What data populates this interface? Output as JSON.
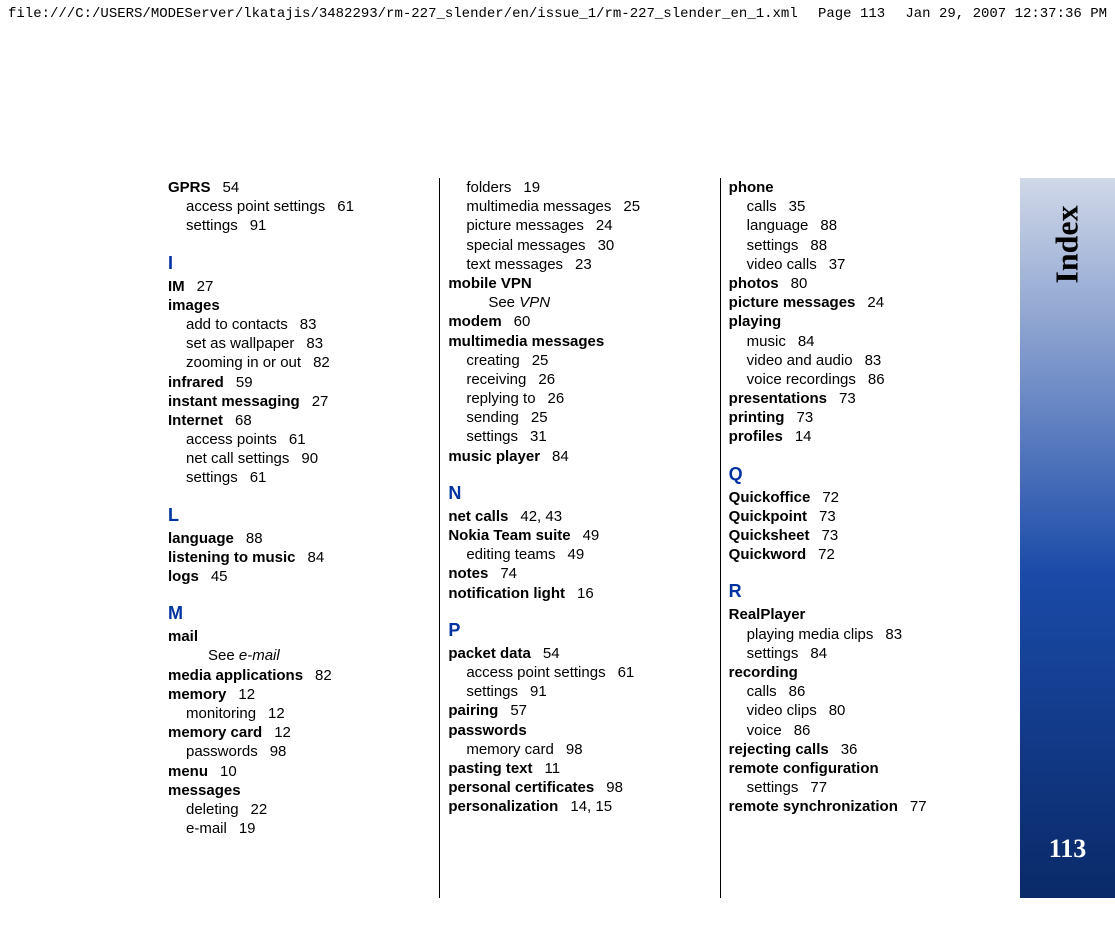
{
  "header": {
    "path": "file:///C:/USERS/MODEServer/lkatajis/3482293/rm-227_slender/en/issue_1/rm-227_slender_en_1.xml",
    "page": "Page 113",
    "timestamp": "Jan 29, 2007 12:37:36 PM"
  },
  "sidebar": {
    "title": "Index",
    "page": "113"
  },
  "col1": [
    {
      "t": "top",
      "text": "GPRS",
      "pg": "54"
    },
    {
      "t": "sub",
      "text": "access point settings",
      "pg": "61"
    },
    {
      "t": "sub",
      "text": "settings",
      "pg": "91"
    },
    {
      "t": "letter",
      "text": "I"
    },
    {
      "t": "top",
      "text": "IM",
      "pg": "27"
    },
    {
      "t": "top",
      "text": "images",
      "pg": ""
    },
    {
      "t": "sub",
      "text": "add to contacts",
      "pg": "83"
    },
    {
      "t": "sub",
      "text": "set as wallpaper",
      "pg": "83"
    },
    {
      "t": "sub",
      "text": "zooming in or out",
      "pg": "82"
    },
    {
      "t": "top",
      "text": "infrared",
      "pg": "59"
    },
    {
      "t": "top",
      "text": "instant messaging",
      "pg": "27"
    },
    {
      "t": "top",
      "text": "Internet",
      "pg": "68"
    },
    {
      "t": "sub",
      "text": "access points",
      "pg": "61"
    },
    {
      "t": "sub",
      "text": "net call settings",
      "pg": "90"
    },
    {
      "t": "sub",
      "text": "settings",
      "pg": "61"
    },
    {
      "t": "letter",
      "text": "L"
    },
    {
      "t": "top",
      "text": "language",
      "pg": "88"
    },
    {
      "t": "top",
      "text": "listening to music",
      "pg": "84"
    },
    {
      "t": "top",
      "text": "logs",
      "pg": "45"
    },
    {
      "t": "letter",
      "text": "M"
    },
    {
      "t": "top",
      "text": "mail",
      "pg": ""
    },
    {
      "t": "see",
      "label": "See ",
      "ref": "e-mail"
    },
    {
      "t": "top",
      "text": "media applications",
      "pg": "82"
    },
    {
      "t": "top",
      "text": "memory",
      "pg": "12"
    },
    {
      "t": "sub",
      "text": "monitoring",
      "pg": "12"
    },
    {
      "t": "top",
      "text": "memory card",
      "pg": "12"
    },
    {
      "t": "sub",
      "text": "passwords",
      "pg": "98"
    },
    {
      "t": "top",
      "text": "menu",
      "pg": "10"
    },
    {
      "t": "top",
      "text": "messages",
      "pg": ""
    },
    {
      "t": "sub",
      "text": "deleting",
      "pg": "22"
    },
    {
      "t": "sub",
      "text": "e-mail",
      "pg": "19"
    }
  ],
  "col2": [
    {
      "t": "sub",
      "text": "folders",
      "pg": "19"
    },
    {
      "t": "sub",
      "text": "multimedia messages",
      "pg": "25"
    },
    {
      "t": "sub",
      "text": "picture messages",
      "pg": "24"
    },
    {
      "t": "sub",
      "text": "special messages",
      "pg": "30"
    },
    {
      "t": "sub",
      "text": "text messages",
      "pg": "23"
    },
    {
      "t": "top",
      "text": "mobile VPN",
      "pg": ""
    },
    {
      "t": "see",
      "label": "See ",
      "ref": "VPN"
    },
    {
      "t": "top",
      "text": "modem",
      "pg": "60"
    },
    {
      "t": "top",
      "text": "multimedia messages",
      "pg": ""
    },
    {
      "t": "sub",
      "text": "creating",
      "pg": "25"
    },
    {
      "t": "sub",
      "text": "receiving",
      "pg": "26"
    },
    {
      "t": "sub",
      "text": "replying to",
      "pg": "26"
    },
    {
      "t": "sub",
      "text": "sending",
      "pg": "25"
    },
    {
      "t": "sub",
      "text": "settings",
      "pg": "31"
    },
    {
      "t": "top",
      "text": "music player",
      "pg": "84"
    },
    {
      "t": "letter",
      "text": "N"
    },
    {
      "t": "top",
      "text": "net calls",
      "pg": "42, 43"
    },
    {
      "t": "top",
      "text": "Nokia Team suite",
      "pg": "49"
    },
    {
      "t": "sub",
      "text": "editing teams",
      "pg": "49"
    },
    {
      "t": "top",
      "text": "notes",
      "pg": "74"
    },
    {
      "t": "top",
      "text": "notification light",
      "pg": "16"
    },
    {
      "t": "letter",
      "text": "P"
    },
    {
      "t": "top",
      "text": "packet data",
      "pg": "54"
    },
    {
      "t": "sub",
      "text": "access point settings",
      "pg": "61"
    },
    {
      "t": "sub",
      "text": "settings",
      "pg": "91"
    },
    {
      "t": "top",
      "text": "pairing",
      "pg": "57"
    },
    {
      "t": "top",
      "text": "passwords",
      "pg": ""
    },
    {
      "t": "sub",
      "text": "memory card",
      "pg": "98"
    },
    {
      "t": "top",
      "text": "pasting text",
      "pg": "11"
    },
    {
      "t": "top",
      "text": "personal certificates",
      "pg": "98"
    },
    {
      "t": "top",
      "text": "personalization",
      "pg": "14, 15"
    }
  ],
  "col3": [
    {
      "t": "top",
      "text": "phone",
      "pg": ""
    },
    {
      "t": "sub",
      "text": "calls",
      "pg": "35"
    },
    {
      "t": "sub",
      "text": "language",
      "pg": "88"
    },
    {
      "t": "sub",
      "text": "settings",
      "pg": "88"
    },
    {
      "t": "sub",
      "text": "video calls",
      "pg": "37"
    },
    {
      "t": "top",
      "text": "photos",
      "pg": "80"
    },
    {
      "t": "top",
      "text": "picture messages",
      "pg": "24"
    },
    {
      "t": "top",
      "text": "playing",
      "pg": ""
    },
    {
      "t": "sub",
      "text": "music",
      "pg": "84"
    },
    {
      "t": "sub",
      "text": "video and audio",
      "pg": "83"
    },
    {
      "t": "sub",
      "text": "voice recordings",
      "pg": "86"
    },
    {
      "t": "top",
      "text": "presentations",
      "pg": "73"
    },
    {
      "t": "top",
      "text": "printing",
      "pg": "73"
    },
    {
      "t": "top",
      "text": "profiles",
      "pg": "14"
    },
    {
      "t": "letter",
      "text": "Q"
    },
    {
      "t": "top",
      "text": "Quickoffice",
      "pg": "72"
    },
    {
      "t": "top",
      "text": "Quickpoint",
      "pg": "73"
    },
    {
      "t": "top",
      "text": "Quicksheet",
      "pg": "73"
    },
    {
      "t": "top",
      "text": "Quickword",
      "pg": "72"
    },
    {
      "t": "letter",
      "text": "R"
    },
    {
      "t": "top",
      "text": "RealPlayer",
      "pg": ""
    },
    {
      "t": "sub",
      "text": "playing media clips",
      "pg": "83"
    },
    {
      "t": "sub",
      "text": "settings",
      "pg": "84"
    },
    {
      "t": "top",
      "text": "recording",
      "pg": ""
    },
    {
      "t": "sub",
      "text": "calls",
      "pg": "86"
    },
    {
      "t": "sub",
      "text": "video clips",
      "pg": "80"
    },
    {
      "t": "sub",
      "text": "voice",
      "pg": "86"
    },
    {
      "t": "top",
      "text": "rejecting calls",
      "pg": "36"
    },
    {
      "t": "top",
      "text": "remote configuration",
      "pg": ""
    },
    {
      "t": "sub",
      "text": "settings",
      "pg": "77"
    },
    {
      "t": "top",
      "text": "remote synchronization",
      "pg": "77"
    }
  ]
}
